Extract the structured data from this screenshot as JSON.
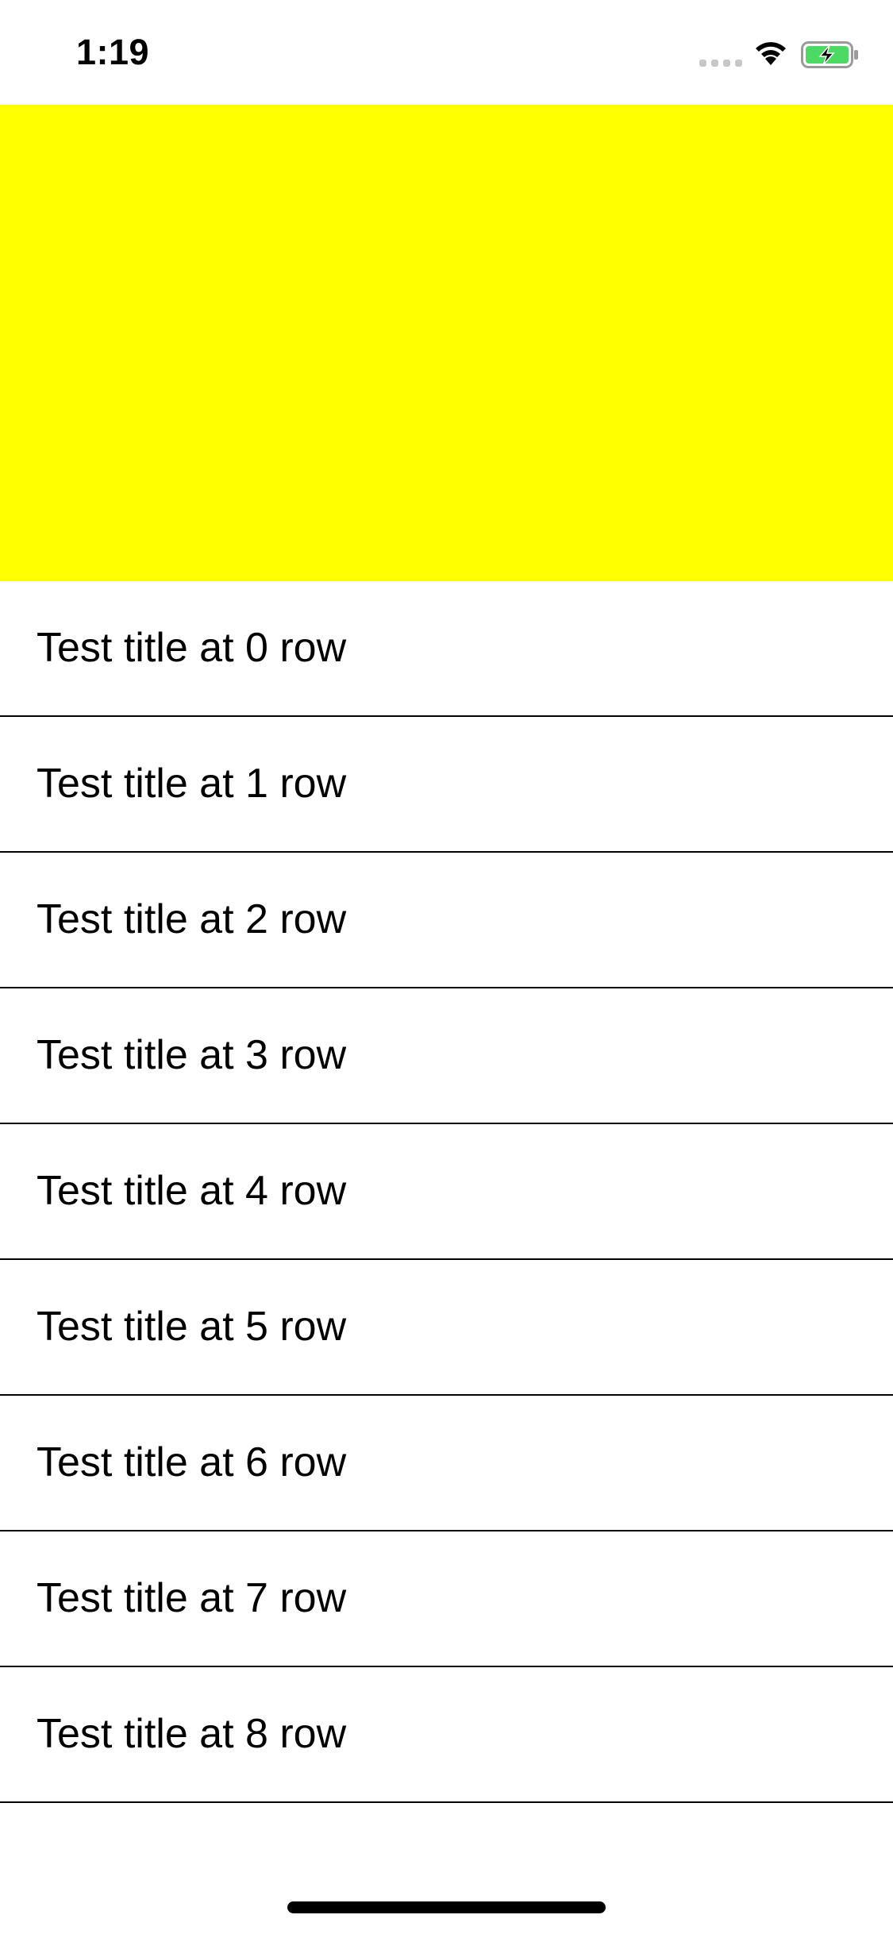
{
  "status_bar": {
    "time": "1:19",
    "icons": [
      "cellular-signal-icon",
      "wifi-icon",
      "battery-charging-icon"
    ],
    "battery_fill_color": "#4cd964"
  },
  "header": {
    "background_color": "#ffff00"
  },
  "table": {
    "rows": [
      {
        "title": "Test title at 0 row"
      },
      {
        "title": "Test title at 1 row"
      },
      {
        "title": "Test title at 2 row"
      },
      {
        "title": "Test title at 3 row"
      },
      {
        "title": "Test title at 4 row"
      },
      {
        "title": "Test title at 5 row"
      },
      {
        "title": "Test title at 6 row"
      },
      {
        "title": "Test title at 7 row"
      },
      {
        "title": "Test title at 8 row"
      }
    ]
  }
}
